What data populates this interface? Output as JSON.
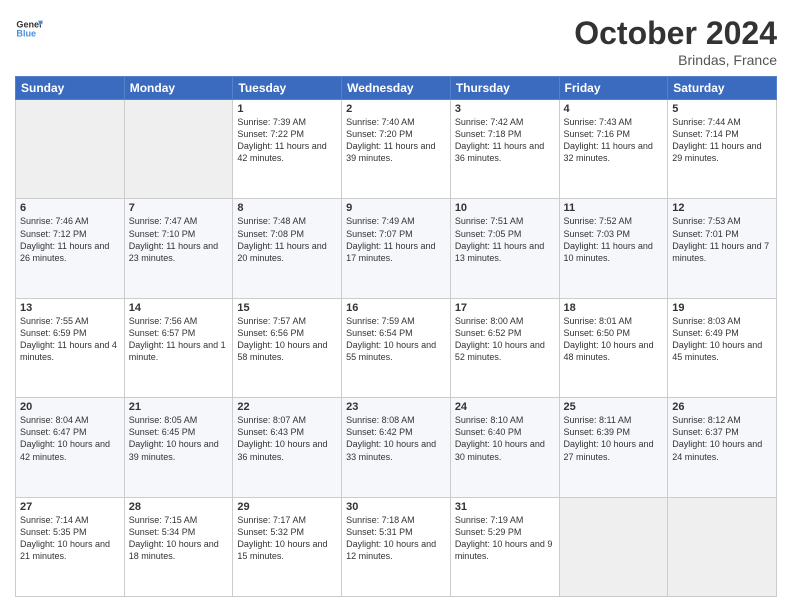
{
  "header": {
    "logo": {
      "line1": "General",
      "line2": "Blue"
    },
    "title": "October 2024",
    "location": "Brindas, France"
  },
  "weekdays": [
    "Sunday",
    "Monday",
    "Tuesday",
    "Wednesday",
    "Thursday",
    "Friday",
    "Saturday"
  ],
  "weeks": [
    [
      {
        "day": "",
        "sunrise": "",
        "sunset": "",
        "daylight": ""
      },
      {
        "day": "",
        "sunrise": "",
        "sunset": "",
        "daylight": ""
      },
      {
        "day": "1",
        "sunrise": "Sunrise: 7:39 AM",
        "sunset": "Sunset: 7:22 PM",
        "daylight": "Daylight: 11 hours and 42 minutes."
      },
      {
        "day": "2",
        "sunrise": "Sunrise: 7:40 AM",
        "sunset": "Sunset: 7:20 PM",
        "daylight": "Daylight: 11 hours and 39 minutes."
      },
      {
        "day": "3",
        "sunrise": "Sunrise: 7:42 AM",
        "sunset": "Sunset: 7:18 PM",
        "daylight": "Daylight: 11 hours and 36 minutes."
      },
      {
        "day": "4",
        "sunrise": "Sunrise: 7:43 AM",
        "sunset": "Sunset: 7:16 PM",
        "daylight": "Daylight: 11 hours and 32 minutes."
      },
      {
        "day": "5",
        "sunrise": "Sunrise: 7:44 AM",
        "sunset": "Sunset: 7:14 PM",
        "daylight": "Daylight: 11 hours and 29 minutes."
      }
    ],
    [
      {
        "day": "6",
        "sunrise": "Sunrise: 7:46 AM",
        "sunset": "Sunset: 7:12 PM",
        "daylight": "Daylight: 11 hours and 26 minutes."
      },
      {
        "day": "7",
        "sunrise": "Sunrise: 7:47 AM",
        "sunset": "Sunset: 7:10 PM",
        "daylight": "Daylight: 11 hours and 23 minutes."
      },
      {
        "day": "8",
        "sunrise": "Sunrise: 7:48 AM",
        "sunset": "Sunset: 7:08 PM",
        "daylight": "Daylight: 11 hours and 20 minutes."
      },
      {
        "day": "9",
        "sunrise": "Sunrise: 7:49 AM",
        "sunset": "Sunset: 7:07 PM",
        "daylight": "Daylight: 11 hours and 17 minutes."
      },
      {
        "day": "10",
        "sunrise": "Sunrise: 7:51 AM",
        "sunset": "Sunset: 7:05 PM",
        "daylight": "Daylight: 11 hours and 13 minutes."
      },
      {
        "day": "11",
        "sunrise": "Sunrise: 7:52 AM",
        "sunset": "Sunset: 7:03 PM",
        "daylight": "Daylight: 11 hours and 10 minutes."
      },
      {
        "day": "12",
        "sunrise": "Sunrise: 7:53 AM",
        "sunset": "Sunset: 7:01 PM",
        "daylight": "Daylight: 11 hours and 7 minutes."
      }
    ],
    [
      {
        "day": "13",
        "sunrise": "Sunrise: 7:55 AM",
        "sunset": "Sunset: 6:59 PM",
        "daylight": "Daylight: 11 hours and 4 minutes."
      },
      {
        "day": "14",
        "sunrise": "Sunrise: 7:56 AM",
        "sunset": "Sunset: 6:57 PM",
        "daylight": "Daylight: 11 hours and 1 minute."
      },
      {
        "day": "15",
        "sunrise": "Sunrise: 7:57 AM",
        "sunset": "Sunset: 6:56 PM",
        "daylight": "Daylight: 10 hours and 58 minutes."
      },
      {
        "day": "16",
        "sunrise": "Sunrise: 7:59 AM",
        "sunset": "Sunset: 6:54 PM",
        "daylight": "Daylight: 10 hours and 55 minutes."
      },
      {
        "day": "17",
        "sunrise": "Sunrise: 8:00 AM",
        "sunset": "Sunset: 6:52 PM",
        "daylight": "Daylight: 10 hours and 52 minutes."
      },
      {
        "day": "18",
        "sunrise": "Sunrise: 8:01 AM",
        "sunset": "Sunset: 6:50 PM",
        "daylight": "Daylight: 10 hours and 48 minutes."
      },
      {
        "day": "19",
        "sunrise": "Sunrise: 8:03 AM",
        "sunset": "Sunset: 6:49 PM",
        "daylight": "Daylight: 10 hours and 45 minutes."
      }
    ],
    [
      {
        "day": "20",
        "sunrise": "Sunrise: 8:04 AM",
        "sunset": "Sunset: 6:47 PM",
        "daylight": "Daylight: 10 hours and 42 minutes."
      },
      {
        "day": "21",
        "sunrise": "Sunrise: 8:05 AM",
        "sunset": "Sunset: 6:45 PM",
        "daylight": "Daylight: 10 hours and 39 minutes."
      },
      {
        "day": "22",
        "sunrise": "Sunrise: 8:07 AM",
        "sunset": "Sunset: 6:43 PM",
        "daylight": "Daylight: 10 hours and 36 minutes."
      },
      {
        "day": "23",
        "sunrise": "Sunrise: 8:08 AM",
        "sunset": "Sunset: 6:42 PM",
        "daylight": "Daylight: 10 hours and 33 minutes."
      },
      {
        "day": "24",
        "sunrise": "Sunrise: 8:10 AM",
        "sunset": "Sunset: 6:40 PM",
        "daylight": "Daylight: 10 hours and 30 minutes."
      },
      {
        "day": "25",
        "sunrise": "Sunrise: 8:11 AM",
        "sunset": "Sunset: 6:39 PM",
        "daylight": "Daylight: 10 hours and 27 minutes."
      },
      {
        "day": "26",
        "sunrise": "Sunrise: 8:12 AM",
        "sunset": "Sunset: 6:37 PM",
        "daylight": "Daylight: 10 hours and 24 minutes."
      }
    ],
    [
      {
        "day": "27",
        "sunrise": "Sunrise: 7:14 AM",
        "sunset": "Sunset: 5:35 PM",
        "daylight": "Daylight: 10 hours and 21 minutes."
      },
      {
        "day": "28",
        "sunrise": "Sunrise: 7:15 AM",
        "sunset": "Sunset: 5:34 PM",
        "daylight": "Daylight: 10 hours and 18 minutes."
      },
      {
        "day": "29",
        "sunrise": "Sunrise: 7:17 AM",
        "sunset": "Sunset: 5:32 PM",
        "daylight": "Daylight: 10 hours and 15 minutes."
      },
      {
        "day": "30",
        "sunrise": "Sunrise: 7:18 AM",
        "sunset": "Sunset: 5:31 PM",
        "daylight": "Daylight: 10 hours and 12 minutes."
      },
      {
        "day": "31",
        "sunrise": "Sunrise: 7:19 AM",
        "sunset": "Sunset: 5:29 PM",
        "daylight": "Daylight: 10 hours and 9 minutes."
      },
      {
        "day": "",
        "sunrise": "",
        "sunset": "",
        "daylight": ""
      },
      {
        "day": "",
        "sunrise": "",
        "sunset": "",
        "daylight": ""
      }
    ]
  ]
}
